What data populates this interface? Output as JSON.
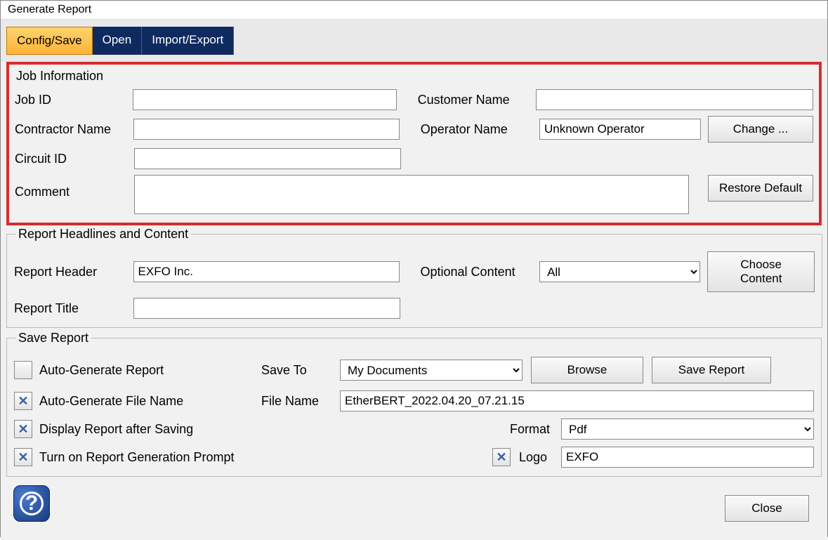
{
  "window": {
    "title": "Generate Report"
  },
  "tabs": {
    "config": "Config/Save",
    "open": "Open",
    "import_export": "Import/Export"
  },
  "job": {
    "legend": "Job Information",
    "job_id_label": "Job ID",
    "job_id": "",
    "customer_label": "Customer Name",
    "customer": "",
    "contractor_label": "Contractor Name",
    "contractor": "",
    "operator_label": "Operator Name",
    "operator": "Unknown Operator",
    "change_btn": "Change ...",
    "circuit_label": "Circuit ID",
    "circuit": "",
    "comment_label": "Comment",
    "comment": "",
    "restore_btn": "Restore Default"
  },
  "headlines": {
    "legend": "Report Headlines and Content",
    "header_label": "Report Header",
    "header": "EXFO Inc.",
    "optional_label": "Optional Content",
    "optional_value": "All",
    "choose_btn": "Choose Content",
    "title_label": "Report Title",
    "title": ""
  },
  "save": {
    "legend": "Save Report",
    "auto_gen_report": "Auto-Generate Report",
    "save_to_label": "Save To",
    "save_to_value": "My Documents",
    "browse_btn": "Browse",
    "save_report_btn": "Save Report",
    "auto_gen_file": "Auto-Generate File Name",
    "file_name_label": "File Name",
    "file_name": "EtherBERT_2022.04.20_07.21.15",
    "display_after": "Display Report after Saving",
    "format_label": "Format",
    "format_value": "Pdf",
    "prompt": "Turn on Report Generation Prompt",
    "logo_label": "Logo",
    "logo_value": "EXFO"
  },
  "footer": {
    "close": "Close",
    "help_tooltip": "Help"
  }
}
